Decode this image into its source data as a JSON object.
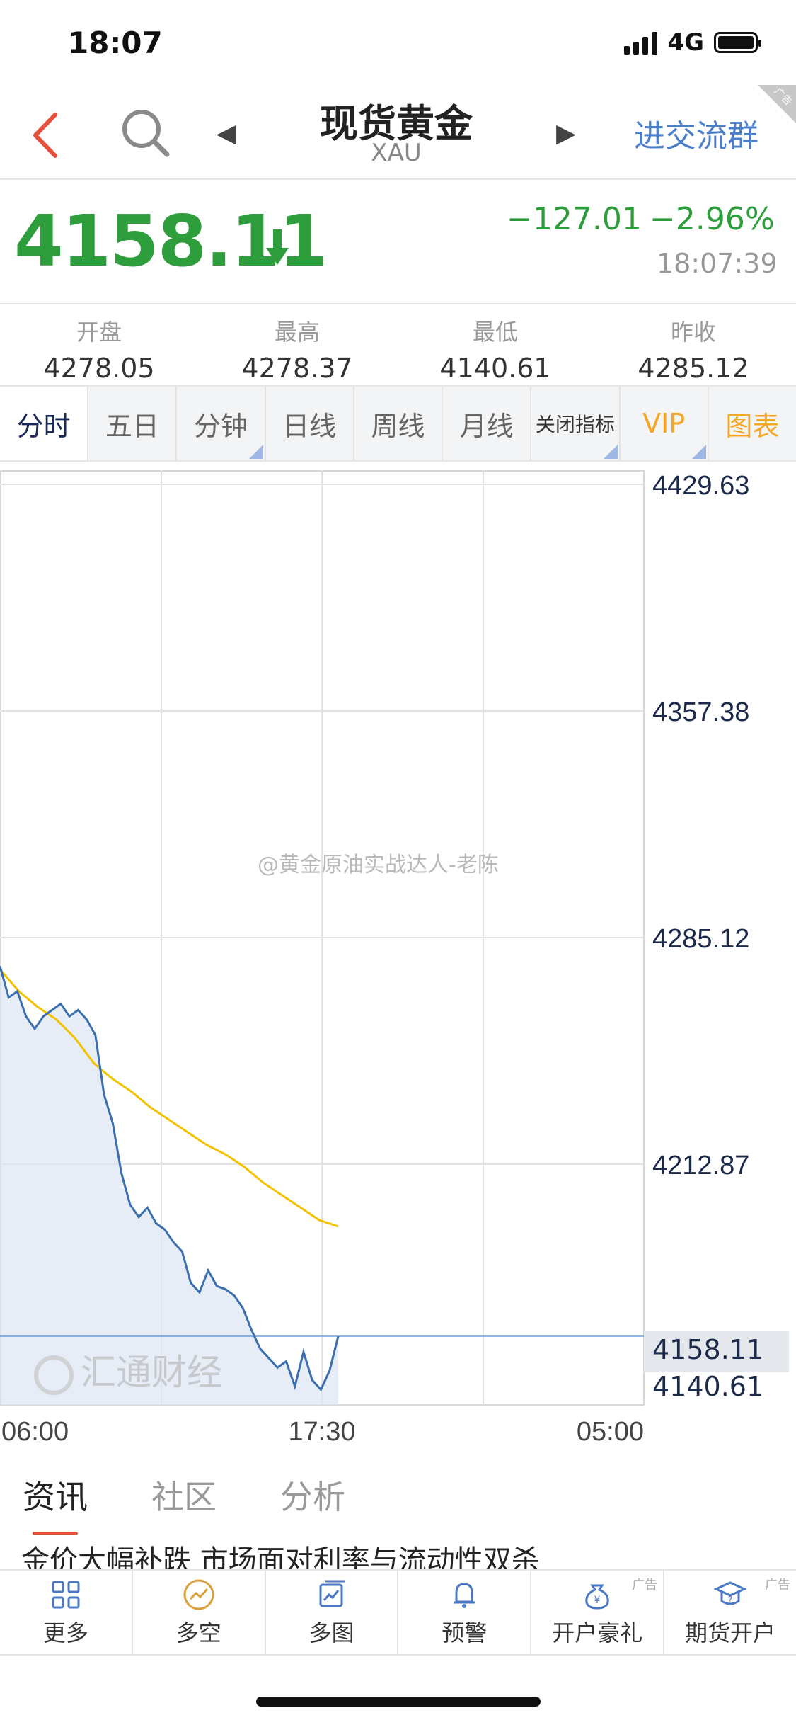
{
  "status_bar": {
    "time": "18:07",
    "network": "4G"
  },
  "header": {
    "title": "现货黄金",
    "subtitle": "XAU",
    "group_button": "进交流群",
    "ad_badge": "广告"
  },
  "quote": {
    "price": "4158.11",
    "change": "−127.01",
    "change_pct": "−2.96%",
    "time": "18:07:39",
    "direction": "down",
    "color": "#2e9e3c"
  },
  "stats": [
    {
      "label": "开盘",
      "value": "4278.05"
    },
    {
      "label": "最高",
      "value": "4278.37"
    },
    {
      "label": "最低",
      "value": "4140.61"
    },
    {
      "label": "昨收",
      "value": "4285.12"
    }
  ],
  "tabs": [
    {
      "label": "分时",
      "active": true
    },
    {
      "label": "五日"
    },
    {
      "label": "分钟"
    },
    {
      "label": "日线"
    },
    {
      "label": "周线"
    },
    {
      "label": "月线"
    },
    {
      "label": "关闭指标"
    },
    {
      "label": "VIP"
    },
    {
      "label": "图表"
    }
  ],
  "chart": {
    "watermark": "@黄金原油实战达人-老陈",
    "logo_watermark": "汇通财经",
    "current_label": "4158.11",
    "low_label": "4140.61",
    "colors": {
      "price_line": "#3b6fb0",
      "avg_line": "#f2c200",
      "fill": "#dbe5f2"
    }
  },
  "chart_data": {
    "type": "line",
    "x_ticks": [
      "06:00",
      "17:30",
      "05:00"
    ],
    "y_ticks": [
      "4429.63",
      "4357.38",
      "4285.12",
      "4212.87"
    ],
    "ylim": [
      4140.61,
      4429.63
    ],
    "reference_close": 4285.12,
    "current_price": 4158.11,
    "series": [
      {
        "values": [
          4276,
          4266,
          4268,
          4260,
          4256,
          4260,
          4262,
          4264,
          4260,
          4262,
          4259,
          4254,
          4235,
          4226,
          4210,
          4200,
          4196,
          4199,
          4194,
          4192,
          4188,
          4185,
          4175,
          4172,
          4179,
          4174,
          4173,
          4171,
          4167,
          4160,
          4154,
          4151,
          4148,
          4150,
          4142,
          4153,
          4144,
          4141,
          4147,
          4158
        ]
      },
      {
        "values": [
          4275,
          4268,
          4263,
          4259,
          4253,
          4245,
          4240,
          4236,
          4231,
          4227,
          4223,
          4219,
          4216,
          4212,
          4207,
          4203,
          4199,
          4195,
          4193
        ]
      }
    ]
  },
  "news": {
    "tabs": [
      {
        "label": "资讯",
        "active": true
      },
      {
        "label": "社区"
      },
      {
        "label": "分析"
      }
    ],
    "headline": "金价大幅补跌 市场面对利率与流动性双杀"
  },
  "bottom_bar": [
    {
      "label": "更多",
      "icon": "grid-icon"
    },
    {
      "label": "多空",
      "icon": "trend-circle-icon"
    },
    {
      "label": "多图",
      "icon": "chart-window-icon"
    },
    {
      "label": "预警",
      "icon": "bell-icon"
    },
    {
      "label": "开户豪礼",
      "icon": "money-bag-icon",
      "ad": "广告"
    },
    {
      "label": "期货开户",
      "icon": "graduation-cap-icon",
      "ad": "广告"
    }
  ]
}
